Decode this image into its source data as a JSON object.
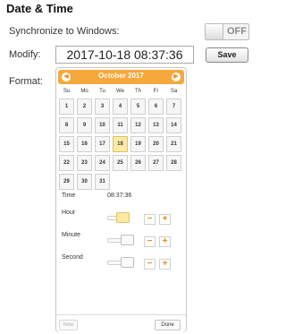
{
  "section": {
    "title": "Date & Time"
  },
  "sync": {
    "label": "Synchronize to Windows:",
    "toggle_text": "OFF"
  },
  "modify": {
    "label": "Modify:",
    "value": "2017-10-18 08:37:36",
    "save_label": "Save"
  },
  "format": {
    "label": "Format:"
  },
  "calendar": {
    "month_title": "October 2017",
    "prev_icon": "chevron-left-icon",
    "next_icon": "chevron-right-icon",
    "accent": "#f6a83c",
    "weekdays": [
      "Su",
      "Mo",
      "Tu",
      "We",
      "Th",
      "Fr",
      "Sa"
    ],
    "weeks": [
      [
        "1",
        "2",
        "3",
        "4",
        "5",
        "6",
        "7"
      ],
      [
        "8",
        "9",
        "10",
        "11",
        "12",
        "13",
        "14"
      ],
      [
        "15",
        "16",
        "17",
        "18",
        "19",
        "20",
        "21"
      ],
      [
        "22",
        "23",
        "24",
        "25",
        "26",
        "27",
        "28"
      ],
      [
        "29",
        "30",
        "31"
      ]
    ],
    "selected_day": "18"
  },
  "time": {
    "label": "Time",
    "value": "08:37:36",
    "hour_label": "Hour",
    "minute_label": "Minute",
    "second_label": "Second",
    "minus": "−",
    "plus": "+"
  },
  "footer": {
    "now_label": "Now",
    "done_label": "Done"
  }
}
